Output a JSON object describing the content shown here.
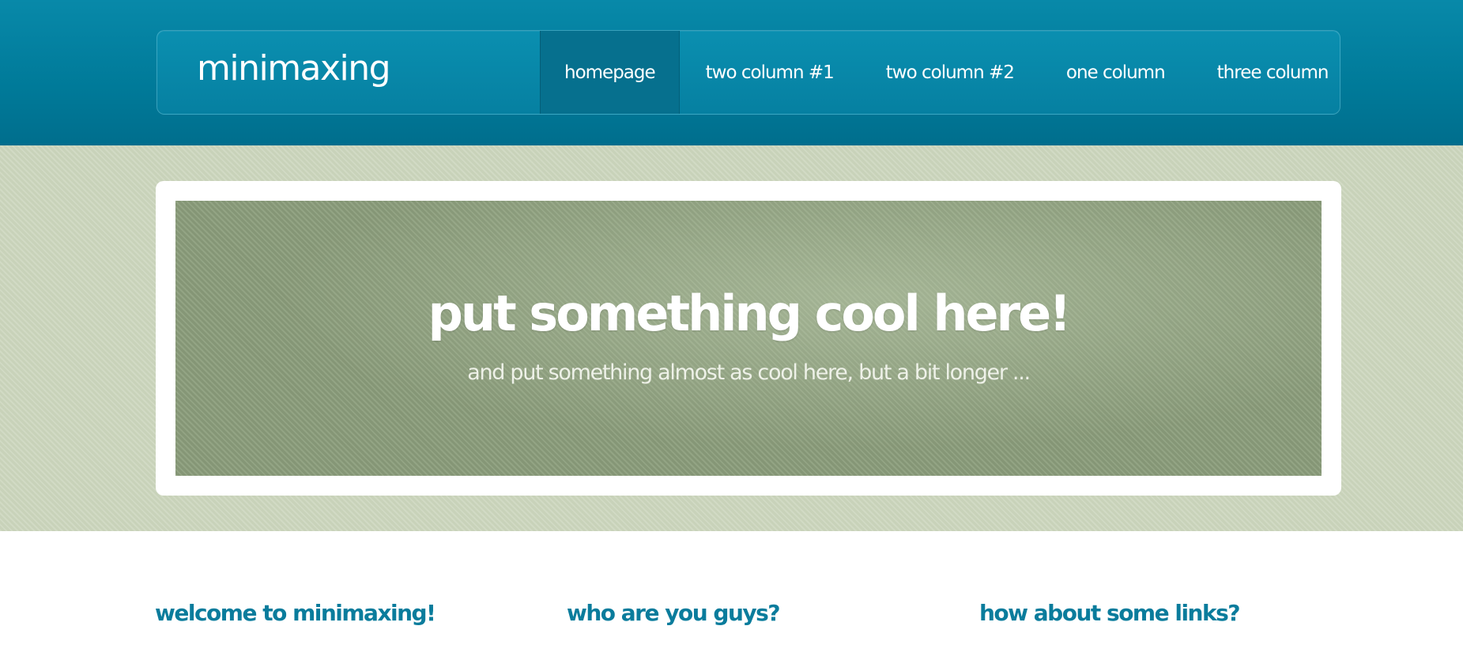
{
  "header": {
    "logo": "minimaxing",
    "nav": [
      {
        "label": "homepage",
        "active": true
      },
      {
        "label": "two column #1",
        "active": false
      },
      {
        "label": "two column #2",
        "active": false
      },
      {
        "label": "one column",
        "active": false
      },
      {
        "label": "three column",
        "active": false
      }
    ]
  },
  "banner": {
    "title": "put something cool here!",
    "subtitle": "and put something almost as cool here, but a bit longer ..."
  },
  "content": {
    "columns": [
      {
        "heading": "welcome to minimaxing!"
      },
      {
        "heading": "who are you guys?"
      },
      {
        "heading": "how about some links?"
      }
    ]
  },
  "colors": {
    "header_bg": "#0a87a8",
    "nav_active_bg": "#06708e",
    "banner_bg": "#ccd6bd",
    "banner_panel": "#8c9e7c",
    "heading_text": "#0a7c9c"
  }
}
